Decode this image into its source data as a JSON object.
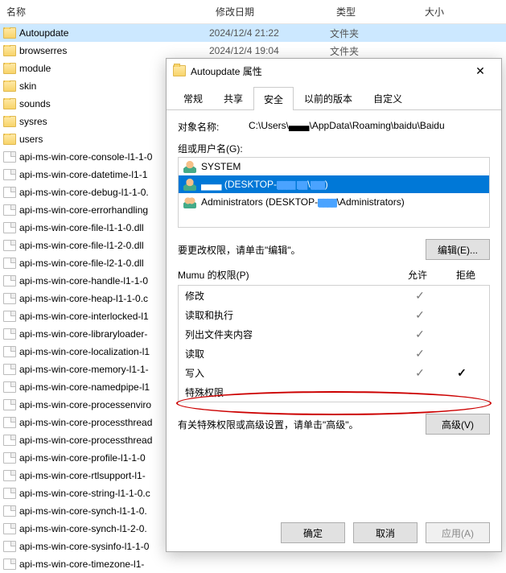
{
  "explorer": {
    "columns": {
      "name": "名称",
      "date": "修改日期",
      "type": "类型",
      "size": "大小"
    },
    "rows": [
      {
        "icon": "folder",
        "name": "Autoupdate",
        "date": "2024/12/4 21:22",
        "type": "文件夹",
        "selected": true
      },
      {
        "icon": "folder",
        "name": "browserres",
        "date": "2024/12/4 19:04",
        "type": "文件夹"
      },
      {
        "icon": "folder",
        "name": "module"
      },
      {
        "icon": "folder",
        "name": "skin"
      },
      {
        "icon": "folder",
        "name": "sounds"
      },
      {
        "icon": "folder",
        "name": "sysres"
      },
      {
        "icon": "folder",
        "name": "users"
      },
      {
        "icon": "file",
        "name": "api-ms-win-core-console-l1-1-0"
      },
      {
        "icon": "file",
        "name": "api-ms-win-core-datetime-l1-1"
      },
      {
        "icon": "file",
        "name": "api-ms-win-core-debug-l1-1-0."
      },
      {
        "icon": "file",
        "name": "api-ms-win-core-errorhandling"
      },
      {
        "icon": "file",
        "name": "api-ms-win-core-file-l1-1-0.dll"
      },
      {
        "icon": "file",
        "name": "api-ms-win-core-file-l1-2-0.dll"
      },
      {
        "icon": "file",
        "name": "api-ms-win-core-file-l2-1-0.dll"
      },
      {
        "icon": "file",
        "name": "api-ms-win-core-handle-l1-1-0"
      },
      {
        "icon": "file",
        "name": "api-ms-win-core-heap-l1-1-0.c"
      },
      {
        "icon": "file",
        "name": "api-ms-win-core-interlocked-l1"
      },
      {
        "icon": "file",
        "name": "api-ms-win-core-libraryloader-"
      },
      {
        "icon": "file",
        "name": "api-ms-win-core-localization-l1"
      },
      {
        "icon": "file",
        "name": "api-ms-win-core-memory-l1-1-"
      },
      {
        "icon": "file",
        "name": "api-ms-win-core-namedpipe-l1"
      },
      {
        "icon": "file",
        "name": "api-ms-win-core-processenviro"
      },
      {
        "icon": "file",
        "name": "api-ms-win-core-processthread"
      },
      {
        "icon": "file",
        "name": "api-ms-win-core-processthread"
      },
      {
        "icon": "file",
        "name": "api-ms-win-core-profile-l1-1-0"
      },
      {
        "icon": "file",
        "name": "api-ms-win-core-rtlsupport-l1-"
      },
      {
        "icon": "file",
        "name": "api-ms-win-core-string-l1-1-0.c"
      },
      {
        "icon": "file",
        "name": "api-ms-win-core-synch-l1-1-0."
      },
      {
        "icon": "file",
        "name": "api-ms-win-core-synch-l1-2-0."
      },
      {
        "icon": "file",
        "name": "api-ms-win-core-sysinfo-l1-1-0"
      },
      {
        "icon": "file",
        "name": "api-ms-win-core-timezone-l1-"
      }
    ]
  },
  "dialog": {
    "title": "Autoupdate 属性",
    "tabs": [
      "常规",
      "共享",
      "安全",
      "以前的版本",
      "自定义"
    ],
    "active_tab": 2,
    "object_label": "对象名称:",
    "object_value": "C:\\Users\\▄▄▄\\AppData\\Roaming\\baidu\\Baidu",
    "group_label": "组或用户名(G):",
    "principals": [
      {
        "icon": "user",
        "label": "SYSTEM"
      },
      {
        "icon": "user",
        "label_prefix": "▄▄▄ (DESKTOP-",
        "label_suffix": ")",
        "masked": true,
        "selected": true
      },
      {
        "icon": "group",
        "label_prefix": "Administrators (DESKTOP-",
        "label_mid": "▄▄▄",
        "label_suffix": "\\Administrators)"
      }
    ],
    "edit_hint": "要更改权限，请单击\"编辑\"。",
    "edit_btn": "编辑(E)...",
    "perm_header_label": "Mumu 的权限(P)",
    "perm_allow": "允许",
    "perm_deny": "拒绝",
    "permissions": [
      {
        "name": "修改",
        "allow": true,
        "deny": false
      },
      {
        "name": "读取和执行",
        "allow": true,
        "deny": false
      },
      {
        "name": "列出文件夹内容",
        "allow": true,
        "deny": false
      },
      {
        "name": "读取",
        "allow": true,
        "deny": false
      },
      {
        "name": "写入",
        "allow": true,
        "deny": true,
        "highlight": true
      },
      {
        "name": "特殊权限",
        "allow": false,
        "deny": false
      }
    ],
    "adv_hint": "有关特殊权限或高级设置，请单击\"高级\"。",
    "adv_btn": "高级(V)",
    "ok": "确定",
    "cancel": "取消",
    "apply": "应用(A)"
  }
}
